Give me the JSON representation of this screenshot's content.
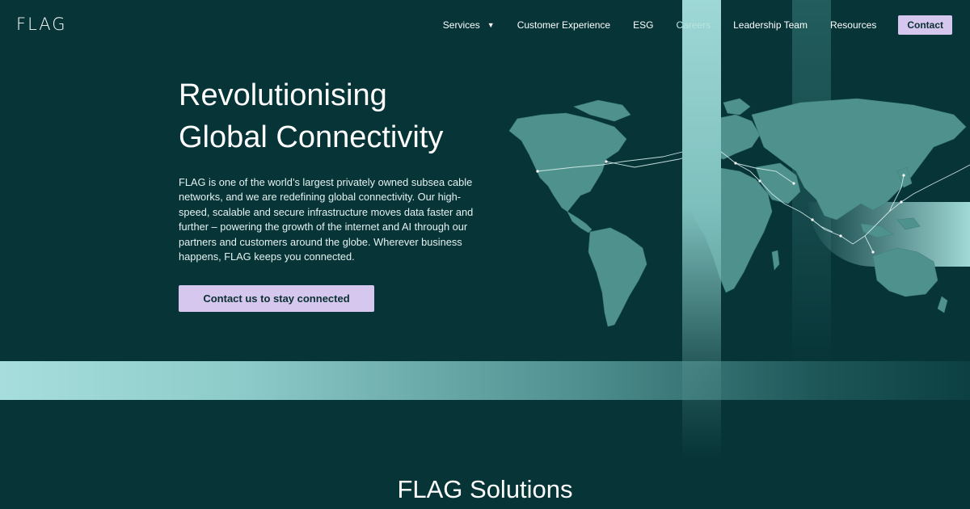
{
  "brand": {
    "logo": "FLAG"
  },
  "nav": {
    "items": [
      {
        "label": "Services",
        "has_dropdown": true
      },
      {
        "label": "Customer Experience"
      },
      {
        "label": "ESG"
      },
      {
        "label": "Careers"
      },
      {
        "label": "Leadership Team"
      },
      {
        "label": "Resources"
      }
    ],
    "contact_label": "Contact"
  },
  "hero": {
    "title_line1": "Revolutionising",
    "title_line2": "Global Connectivity",
    "description": "FLAG is one of the world’s largest privately owned subsea cable networks, and we are redefining global connectivity. Our high-speed, scalable and secure infrastructure moves data faster and further – powering the growth of the internet and AI through our partners and customers around the globe. Wherever business happens, FLAG keeps you connected.",
    "cta_label": "Contact us to stay connected"
  },
  "solutions": {
    "title": "FLAG Solutions"
  },
  "colors": {
    "background": "#063437",
    "accent_button": "#d6c7ef",
    "band_light": "#a7dedd",
    "map_land": "#4f928d"
  },
  "icons": {
    "dropdown": "caret-down-icon",
    "map": "world-map-icon"
  }
}
